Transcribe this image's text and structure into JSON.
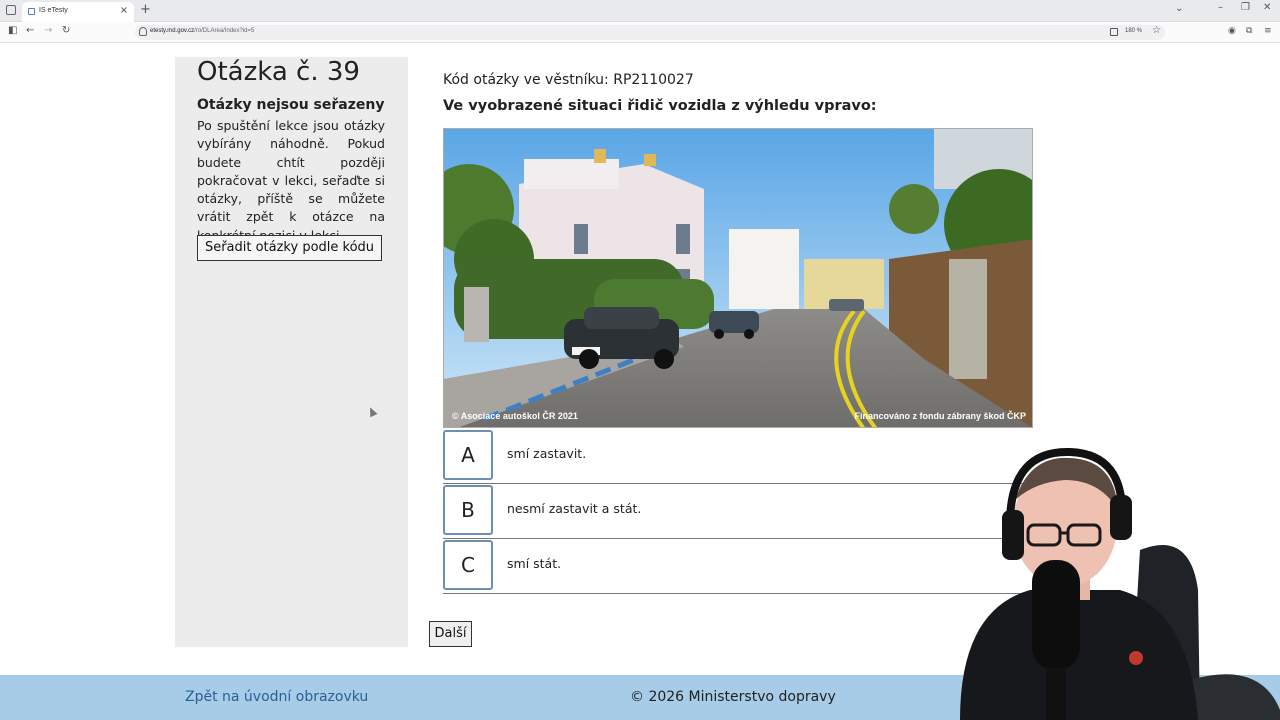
{
  "browser": {
    "tab_title": "IS eTesty",
    "tab_close": "×",
    "new_tab": "+",
    "url_host": "etesty.md.gov.cz",
    "url_path": "/ro/DLArea/Index?id=5",
    "zoom": "180 %"
  },
  "sidebar": {
    "question_number": "Otázka č. 39",
    "unsorted_title": "Otázky nejsou seřazeny",
    "unsorted_text": "Po spuštění lekce jsou otázky vybírány náhodně. Pokud budete chtít později pokračovat v lekci, seřaďte si otázky, příště se můžete vrátit zpět k otázce na konkrétní pozici v lekci.",
    "sort_button": "Seřadit otázky podle kódu"
  },
  "question": {
    "code_line": "Kód otázky ve věstníku: RP2110027",
    "text": "Ve vyobrazené situaci řidič vozidla z výhledu vpravo:",
    "photo_credit_left": "© Asociace autoškol ČR 2021",
    "photo_credit_right": "Financováno z fondu zábrany škod ČKP"
  },
  "answers": [
    {
      "letter": "A",
      "text": "smí zastavit."
    },
    {
      "letter": "B",
      "text": "nesmí zastavit a stát."
    },
    {
      "letter": "C",
      "text": "smí stát."
    }
  ],
  "next_button": "Další",
  "footer": {
    "back_link": "Zpět na úvodní obrazovku",
    "copyright": "© 2026 Ministerstvo dopravy"
  }
}
